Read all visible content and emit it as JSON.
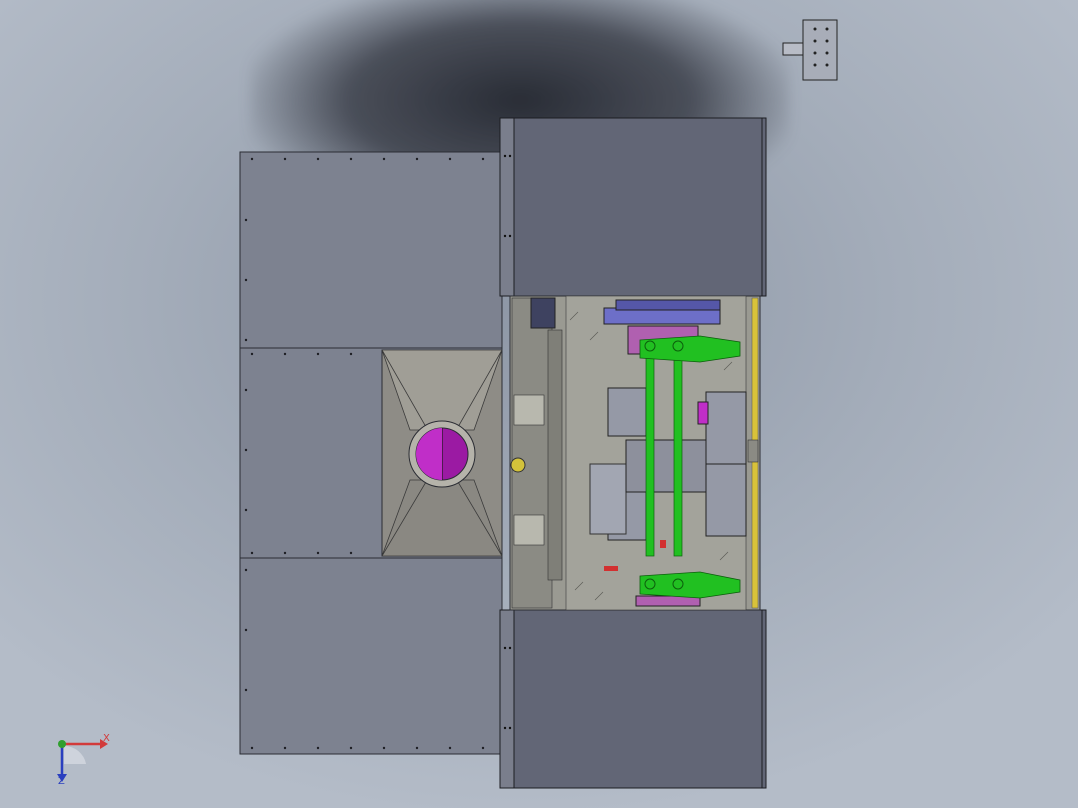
{
  "viewport": {
    "background_colors": [
      "#8e97a6",
      "#b4bcc8"
    ],
    "colors": {
      "panel": "#7d8290",
      "panel_dark": "#626676",
      "frame": "#2a2c33",
      "machine_bg": "#9a9a92",
      "green": "#21c021",
      "magenta": "#a01aa8",
      "blue_plate": "#6d6fc8",
      "yellow": "#d8c23a"
    }
  },
  "triad": {
    "x_label": "X",
    "z_label": "Z",
    "y_label": ""
  },
  "parts": {
    "left_panel": "sheet-metal-cover",
    "top_right_block": "guard-block",
    "bottom_right_block": "guard-block",
    "hopper": "funnel-hopper",
    "hopper_port": "magenta-port",
    "mechanism": "linkage-mechanism",
    "small_part": "connector-block"
  }
}
